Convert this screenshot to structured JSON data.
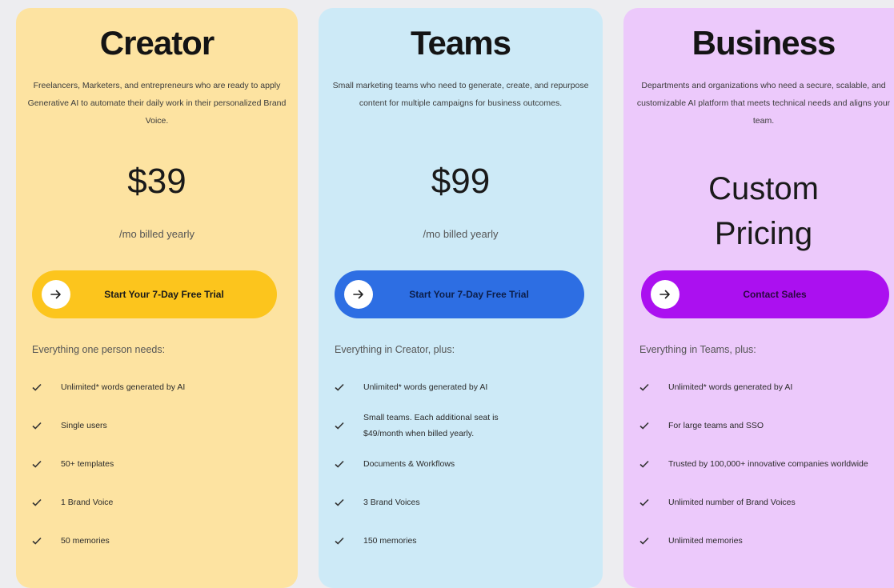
{
  "plans": [
    {
      "name": "Creator",
      "description": "Freelancers, Marketers, and entrepreneurs who are ready to apply Generative AI to automate their daily work in their personalized Brand Voice.",
      "price": "$39",
      "period": "/mo billed yearly",
      "cta": "Start Your 7-Day Free Trial",
      "features_heading": "Everything one person needs:",
      "features": [
        "Unlimited* words generated by AI",
        "Single users",
        "50+ templates",
        "1 Brand Voice",
        "50 memories"
      ]
    },
    {
      "name": "Teams",
      "description": "Small marketing teams who need to generate, create, and repurpose content for multiple campaigns for business outcomes.",
      "price": "$99",
      "period": "/mo billed yearly",
      "cta": "Start Your 7-Day Free Trial",
      "features_heading": "Everything in Creator, plus:",
      "features": [
        "Unlimited* words generated by AI",
        "Small teams. Each additional seat is $49/month when billed yearly.",
        "Documents & Workflows",
        "3 Brand Voices",
        "150 memories"
      ]
    },
    {
      "name": "Business",
      "description": "Departments and organizations who need a secure, scalable, and customizable AI platform that meets technical needs and aligns your team.",
      "price_line1": "Custom",
      "price_line2": "Pricing",
      "cta": "Contact Sales",
      "features_heading": "Everything in Teams, plus:",
      "features": [
        "Unlimited* words generated by AI",
        "For large teams and SSO",
        "Trusted by 100,000+ innovative companies worldwide",
        "Unlimited number of Brand Voices",
        "Unlimited memories"
      ]
    }
  ],
  "colors": {
    "creator_card": "#fde3a1",
    "creator_cta": "#fcc51d",
    "teams_card": "#cdeaf7",
    "teams_cta": "#2d6ee3",
    "business_card": "#ecc9fb",
    "business_cta": "#ab10f0"
  },
  "icons": {
    "cta": "arrow-right-icon",
    "feature": "check-icon"
  }
}
